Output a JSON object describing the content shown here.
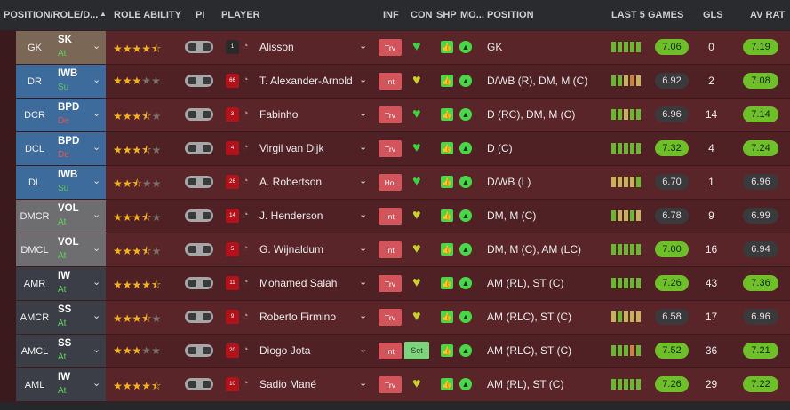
{
  "colors": {
    "bar_good": "#6fb535",
    "bar_mid": "#c7b05f",
    "bar_low": "#c98147",
    "bar_bad": "#cf3a3a",
    "rating_green": "#6fbf2a",
    "rating_grey": "#3a3a3c",
    "duty_support": "#5fc35f",
    "duty_defend": "#e25555",
    "duty_attack": "#5fd35f",
    "pos_gk": "#7b6756",
    "pos_def": "#3d6b9c",
    "pos_mid": "#6e6e70",
    "pos_att": "#3b3e46"
  },
  "headers": {
    "position": "POSITION/ROLE/D...",
    "role_ability": "ROLE ABILITY",
    "pi": "PI",
    "player": "PLAYER",
    "inf": "INF",
    "con": "CON",
    "shp": "SHP",
    "mo": "MO...",
    "position_detail": "POSITION",
    "last5": "LAST 5 GAMES",
    "gls": "GLS",
    "avrat": "AV RAT"
  },
  "sort_icon": "triangle-up-icon",
  "rows": [
    {
      "pos": "GK",
      "pos_group": "gk",
      "role": "SK",
      "duty": "At",
      "duty_type": "attack",
      "stars": 4.5,
      "shirt": "1",
      "shirt_type": "gk",
      "name": "Alisson",
      "inf": "Trv",
      "con": "heart",
      "detail": "GK",
      "bars": [
        "good",
        "good",
        "good",
        "good",
        "good"
      ],
      "rating": "7.06",
      "rating_hi": true,
      "gls": "0",
      "avrat": "7.19",
      "avrat_hi": true
    },
    {
      "pos": "DR",
      "pos_group": "def",
      "role": "IWB",
      "duty": "Su",
      "duty_type": "support",
      "stars": 3,
      "shirt": "66",
      "shirt_type": "field",
      "name": "T. Alexander-Arnold",
      "inf": "Int",
      "con": "heart-yellow",
      "detail": "D/WB (R), DM, M (C)",
      "bars": [
        "good",
        "good",
        "mid",
        "low",
        "mid"
      ],
      "rating": "6.92",
      "rating_hi": false,
      "gls": "2",
      "avrat": "7.08",
      "avrat_hi": true
    },
    {
      "pos": "DCR",
      "pos_group": "def",
      "role": "BPD",
      "duty": "De",
      "duty_type": "defend",
      "stars": 3.5,
      "shirt": "3",
      "shirt_type": "field",
      "name": "Fabinho",
      "inf": "Trv",
      "con": "heart",
      "detail": "D (RC), DM, M (C)",
      "bars": [
        "good",
        "good",
        "mid",
        "good",
        "good"
      ],
      "rating": "6.96",
      "rating_hi": false,
      "gls": "14",
      "avrat": "7.14",
      "avrat_hi": true
    },
    {
      "pos": "DCL",
      "pos_group": "def",
      "role": "BPD",
      "duty": "De",
      "duty_type": "defend",
      "stars": 3.5,
      "shirt": "4",
      "shirt_type": "field",
      "name": "Virgil van Dijk",
      "inf": "Trv",
      "con": "heart",
      "detail": "D (C)",
      "bars": [
        "good",
        "good",
        "good",
        "good",
        "good"
      ],
      "rating": "7.32",
      "rating_hi": true,
      "gls": "4",
      "avrat": "7.24",
      "avrat_hi": true
    },
    {
      "pos": "DL",
      "pos_group": "def",
      "role": "IWB",
      "duty": "Su",
      "duty_type": "support",
      "stars": 2.5,
      "shirt": "26",
      "shirt_type": "field",
      "name": "A. Robertson",
      "inf": "Hol",
      "con": "heart",
      "detail": "D/WB (L)",
      "bars": [
        "mid",
        "mid",
        "mid",
        "mid",
        "good"
      ],
      "rating": "6.70",
      "rating_hi": false,
      "gls": "1",
      "avrat": "6.96",
      "avrat_hi": false
    },
    {
      "pos": "DMCR",
      "pos_group": "mid",
      "role": "VOL",
      "duty": "At",
      "duty_type": "attack",
      "stars": 3.5,
      "shirt": "14",
      "shirt_type": "field",
      "name": "J. Henderson",
      "inf": "Int",
      "con": "heart-yellow",
      "detail": "DM, M (C)",
      "bars": [
        "good",
        "mid",
        "mid",
        "good",
        "mid"
      ],
      "rating": "6.78",
      "rating_hi": false,
      "gls": "9",
      "avrat": "6.99",
      "avrat_hi": false
    },
    {
      "pos": "DMCL",
      "pos_group": "mid",
      "role": "VOL",
      "duty": "At",
      "duty_type": "attack",
      "stars": 3.5,
      "shirt": "5",
      "shirt_type": "field",
      "name": "G. Wijnaldum",
      "inf": "Int",
      "con": "heart-yellow",
      "detail": "DM, M (C), AM (LC)",
      "bars": [
        "good",
        "good",
        "good",
        "good",
        "good"
      ],
      "rating": "7.00",
      "rating_hi": true,
      "gls": "16",
      "avrat": "6.94",
      "avrat_hi": false
    },
    {
      "pos": "AMR",
      "pos_group": "att",
      "role": "IW",
      "duty": "At",
      "duty_type": "attack",
      "stars": 4.5,
      "shirt": "11",
      "shirt_type": "field",
      "name": "Mohamed Salah",
      "inf": "Trv",
      "con": "heart-yellow",
      "detail": "AM (RL), ST (C)",
      "bars": [
        "good",
        "good",
        "good",
        "good",
        "good"
      ],
      "rating": "7.26",
      "rating_hi": true,
      "gls": "43",
      "avrat": "7.36",
      "avrat_hi": true
    },
    {
      "pos": "AMCR",
      "pos_group": "att",
      "role": "SS",
      "duty": "At",
      "duty_type": "attack",
      "stars": 3.5,
      "shirt": "9",
      "shirt_type": "field",
      "name": "Roberto Firmino",
      "inf": "Trv",
      "con": "heart-yellow",
      "detail": "AM (RLC), ST (C)",
      "bars": [
        "mid",
        "good",
        "mid",
        "mid",
        "mid"
      ],
      "rating": "6.58",
      "rating_hi": false,
      "gls": "17",
      "avrat": "6.96",
      "avrat_hi": false
    },
    {
      "pos": "AMCL",
      "pos_group": "att",
      "role": "SS",
      "duty": "At",
      "duty_type": "attack",
      "stars": 3,
      "shirt": "20",
      "shirt_type": "field",
      "name": "Diogo Jota",
      "inf": "Int",
      "con": "Set",
      "detail": "AM (RLC), ST (C)",
      "bars": [
        "good",
        "good",
        "good",
        "low",
        "good"
      ],
      "rating": "7.52",
      "rating_hi": true,
      "gls": "36",
      "avrat": "7.21",
      "avrat_hi": true
    },
    {
      "pos": "AML",
      "pos_group": "att",
      "role": "IW",
      "duty": "At",
      "duty_type": "attack",
      "stars": 4.5,
      "shirt": "10",
      "shirt_type": "field",
      "name": "Sadio Mané",
      "inf": "Trv",
      "con": "heart-yellow",
      "detail": "AM (RL), ST (C)",
      "bars": [
        "good",
        "good",
        "good",
        "good",
        "good"
      ],
      "rating": "7.26",
      "rating_hi": true,
      "gls": "29",
      "avrat": "7.22",
      "avrat_hi": true
    }
  ]
}
